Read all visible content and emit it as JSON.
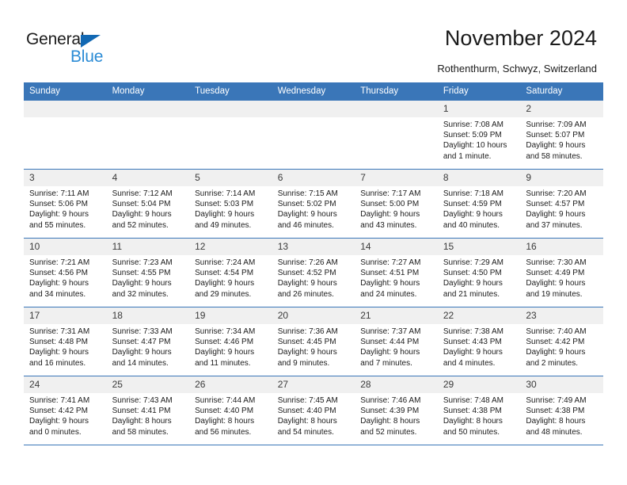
{
  "brand": {
    "name_part1": "General",
    "name_part2": "Blue",
    "triangle_color": "#1268b3",
    "blue_color": "#2a8bd5"
  },
  "header": {
    "title": "November 2024",
    "subtitle": "Rothenthurm, Schwyz, Switzerland",
    "header_bg_color": "#3a76b8",
    "daynum_bg_color": "#f0f0f0"
  },
  "weekdays": [
    "Sunday",
    "Monday",
    "Tuesday",
    "Wednesday",
    "Thursday",
    "Friday",
    "Saturday"
  ],
  "weeks": [
    [
      {
        "empty": true
      },
      {
        "empty": true
      },
      {
        "empty": true
      },
      {
        "empty": true
      },
      {
        "empty": true
      },
      {
        "day": "1",
        "sunrise": "Sunrise: 7:08 AM",
        "sunset": "Sunset: 5:09 PM",
        "daylight": "Daylight: 10 hours and 1 minute."
      },
      {
        "day": "2",
        "sunrise": "Sunrise: 7:09 AM",
        "sunset": "Sunset: 5:07 PM",
        "daylight": "Daylight: 9 hours and 58 minutes."
      }
    ],
    [
      {
        "day": "3",
        "sunrise": "Sunrise: 7:11 AM",
        "sunset": "Sunset: 5:06 PM",
        "daylight": "Daylight: 9 hours and 55 minutes."
      },
      {
        "day": "4",
        "sunrise": "Sunrise: 7:12 AM",
        "sunset": "Sunset: 5:04 PM",
        "daylight": "Daylight: 9 hours and 52 minutes."
      },
      {
        "day": "5",
        "sunrise": "Sunrise: 7:14 AM",
        "sunset": "Sunset: 5:03 PM",
        "daylight": "Daylight: 9 hours and 49 minutes."
      },
      {
        "day": "6",
        "sunrise": "Sunrise: 7:15 AM",
        "sunset": "Sunset: 5:02 PM",
        "daylight": "Daylight: 9 hours and 46 minutes."
      },
      {
        "day": "7",
        "sunrise": "Sunrise: 7:17 AM",
        "sunset": "Sunset: 5:00 PM",
        "daylight": "Daylight: 9 hours and 43 minutes."
      },
      {
        "day": "8",
        "sunrise": "Sunrise: 7:18 AM",
        "sunset": "Sunset: 4:59 PM",
        "daylight": "Daylight: 9 hours and 40 minutes."
      },
      {
        "day": "9",
        "sunrise": "Sunrise: 7:20 AM",
        "sunset": "Sunset: 4:57 PM",
        "daylight": "Daylight: 9 hours and 37 minutes."
      }
    ],
    [
      {
        "day": "10",
        "sunrise": "Sunrise: 7:21 AM",
        "sunset": "Sunset: 4:56 PM",
        "daylight": "Daylight: 9 hours and 34 minutes."
      },
      {
        "day": "11",
        "sunrise": "Sunrise: 7:23 AM",
        "sunset": "Sunset: 4:55 PM",
        "daylight": "Daylight: 9 hours and 32 minutes."
      },
      {
        "day": "12",
        "sunrise": "Sunrise: 7:24 AM",
        "sunset": "Sunset: 4:54 PM",
        "daylight": "Daylight: 9 hours and 29 minutes."
      },
      {
        "day": "13",
        "sunrise": "Sunrise: 7:26 AM",
        "sunset": "Sunset: 4:52 PM",
        "daylight": "Daylight: 9 hours and 26 minutes."
      },
      {
        "day": "14",
        "sunrise": "Sunrise: 7:27 AM",
        "sunset": "Sunset: 4:51 PM",
        "daylight": "Daylight: 9 hours and 24 minutes."
      },
      {
        "day": "15",
        "sunrise": "Sunrise: 7:29 AM",
        "sunset": "Sunset: 4:50 PM",
        "daylight": "Daylight: 9 hours and 21 minutes."
      },
      {
        "day": "16",
        "sunrise": "Sunrise: 7:30 AM",
        "sunset": "Sunset: 4:49 PM",
        "daylight": "Daylight: 9 hours and 19 minutes."
      }
    ],
    [
      {
        "day": "17",
        "sunrise": "Sunrise: 7:31 AM",
        "sunset": "Sunset: 4:48 PM",
        "daylight": "Daylight: 9 hours and 16 minutes."
      },
      {
        "day": "18",
        "sunrise": "Sunrise: 7:33 AM",
        "sunset": "Sunset: 4:47 PM",
        "daylight": "Daylight: 9 hours and 14 minutes."
      },
      {
        "day": "19",
        "sunrise": "Sunrise: 7:34 AM",
        "sunset": "Sunset: 4:46 PM",
        "daylight": "Daylight: 9 hours and 11 minutes."
      },
      {
        "day": "20",
        "sunrise": "Sunrise: 7:36 AM",
        "sunset": "Sunset: 4:45 PM",
        "daylight": "Daylight: 9 hours and 9 minutes."
      },
      {
        "day": "21",
        "sunrise": "Sunrise: 7:37 AM",
        "sunset": "Sunset: 4:44 PM",
        "daylight": "Daylight: 9 hours and 7 minutes."
      },
      {
        "day": "22",
        "sunrise": "Sunrise: 7:38 AM",
        "sunset": "Sunset: 4:43 PM",
        "daylight": "Daylight: 9 hours and 4 minutes."
      },
      {
        "day": "23",
        "sunrise": "Sunrise: 7:40 AM",
        "sunset": "Sunset: 4:42 PM",
        "daylight": "Daylight: 9 hours and 2 minutes."
      }
    ],
    [
      {
        "day": "24",
        "sunrise": "Sunrise: 7:41 AM",
        "sunset": "Sunset: 4:42 PM",
        "daylight": "Daylight: 9 hours and 0 minutes."
      },
      {
        "day": "25",
        "sunrise": "Sunrise: 7:43 AM",
        "sunset": "Sunset: 4:41 PM",
        "daylight": "Daylight: 8 hours and 58 minutes."
      },
      {
        "day": "26",
        "sunrise": "Sunrise: 7:44 AM",
        "sunset": "Sunset: 4:40 PM",
        "daylight": "Daylight: 8 hours and 56 minutes."
      },
      {
        "day": "27",
        "sunrise": "Sunrise: 7:45 AM",
        "sunset": "Sunset: 4:40 PM",
        "daylight": "Daylight: 8 hours and 54 minutes."
      },
      {
        "day": "28",
        "sunrise": "Sunrise: 7:46 AM",
        "sunset": "Sunset: 4:39 PM",
        "daylight": "Daylight: 8 hours and 52 minutes."
      },
      {
        "day": "29",
        "sunrise": "Sunrise: 7:48 AM",
        "sunset": "Sunset: 4:38 PM",
        "daylight": "Daylight: 8 hours and 50 minutes."
      },
      {
        "day": "30",
        "sunrise": "Sunrise: 7:49 AM",
        "sunset": "Sunset: 4:38 PM",
        "daylight": "Daylight: 8 hours and 48 minutes."
      }
    ]
  ]
}
